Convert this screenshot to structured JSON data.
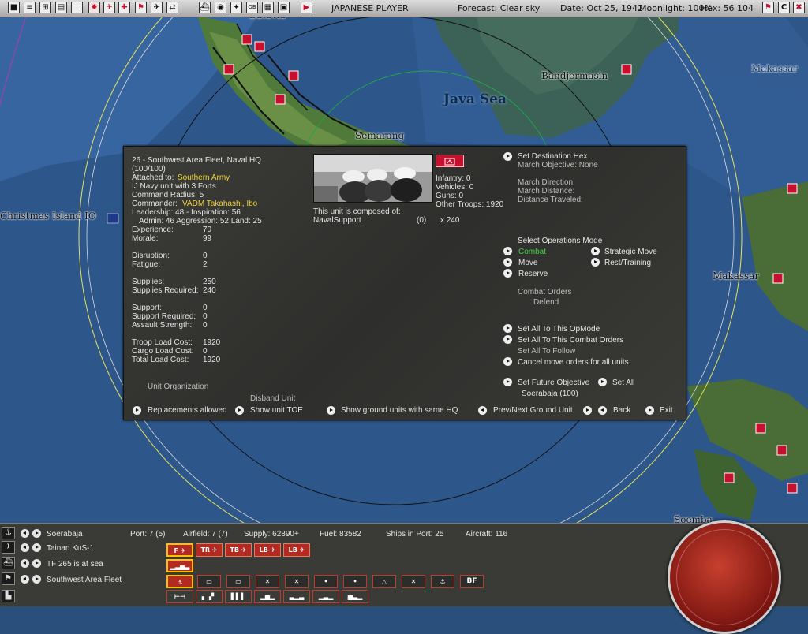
{
  "topbar": {
    "player": "JAPANESE PLAYER",
    "forecast": "Forecast: Clear sky",
    "date": "Date: Oct 25, 1942",
    "moonlight": "Moonlight: 100%",
    "hex": "Hex: 56 104",
    "close_label": "C"
  },
  "map": {
    "labels": {
      "batavia": "Batavia",
      "bandjermasin": "Bandjermasin",
      "java_sea": "Java Sea",
      "semarang": "Semarang",
      "christmas_island": "Christmas Island IO",
      "makassar": "Makassar",
      "makassar_top": "Makassar",
      "soemba": "Soemba"
    }
  },
  "unit": {
    "name": "26 - Southwest Area Fleet, Naval HQ",
    "strength": "(100/100)",
    "attached_label": "Attached to:",
    "attached_value": "Southern Army",
    "type_line": "IJ Navy unit with 3 Forts",
    "command_radius": "Command Radius: 5",
    "commander_label": "Commander:",
    "commander_value": "VADM Takahashi, Ibo",
    "leadership": "Leadership: 48 - Inspiration: 56",
    "admin": "Admin: 46  Aggression: 52  Land: 25",
    "stats": [
      {
        "label": "Experience:",
        "value": "70"
      },
      {
        "label": "Morale:",
        "value": "99"
      },
      {
        "label": "Disruption:",
        "value": "0"
      },
      {
        "label": "Fatigue:",
        "value": "2"
      },
      {
        "label": "Supplies:",
        "value": "250"
      },
      {
        "label": "Supplies Required:",
        "value": "240"
      },
      {
        "label": "Support:",
        "value": "0"
      },
      {
        "label": "Support Required:",
        "value": "0"
      },
      {
        "label": "Assault Strength:",
        "value": "0"
      },
      {
        "label": "Troop Load Cost:",
        "value": "1920"
      },
      {
        "label": "Cargo Load Cost:",
        "value": "0"
      },
      {
        "label": "Total Load Cost:",
        "value": "1920"
      }
    ],
    "infantry": "Infantry: 0",
    "vehicles": "Vehicles: 0",
    "guns": "Guns: 0",
    "other_troops": "Other Troops: 1920",
    "composed_of": "This unit is composed of:",
    "composition_name": "NavalSupport",
    "composition_zero": "(0)",
    "composition_count": "x 240"
  },
  "orders": {
    "set_destination": "Set Destination Hex",
    "march_objective": "March Objective: None",
    "march_direction": "March Direction:",
    "march_distance": "March Distance:",
    "distance_traveled": "Distance Traveled:",
    "select_mode": "Select Operations Mode",
    "combat": "Combat",
    "strategic_move": "Strategic Move",
    "move": "Move",
    "rest_training": "Rest/Training",
    "reserve": "Reserve",
    "combat_orders": "Combat Orders",
    "defend": "Defend",
    "set_all_opmode": "Set All To This OpMode",
    "set_all_combat": "Set All To This Combat Orders",
    "set_all_follow": "Set All To Follow",
    "cancel_move": "Cancel move orders for all units",
    "set_future": "Set Future Objective",
    "set_all": "Set All",
    "future_target": "Soerabaja (100)"
  },
  "footer": {
    "unit_org": "Unit Organization",
    "disband": "Disband Unit",
    "replacements": "Replacements allowed",
    "show_toe": "Show unit TOE",
    "show_same_hq": "Show ground units with same HQ",
    "prev_next": "Prev/Next Ground Unit",
    "back": "Back",
    "exit": "Exit"
  },
  "bottom": {
    "base": "Soerabaja",
    "airgroup": "Tainan KuS-1",
    "taskforce": "TF 265 is at sea",
    "hq": "Southwest Area Fleet",
    "port": "Port: 7 (5)",
    "airfield": "Airfield: 7 (7)",
    "supply": "Supply: 62890+",
    "fuel": "Fuel: 83582",
    "ships_in_port": "Ships in Port: 25",
    "aircraft": "Aircraft: 116",
    "air_icons": [
      "F",
      "TR",
      "TB",
      "LB",
      "LB"
    ],
    "bf_label": "BF"
  }
}
